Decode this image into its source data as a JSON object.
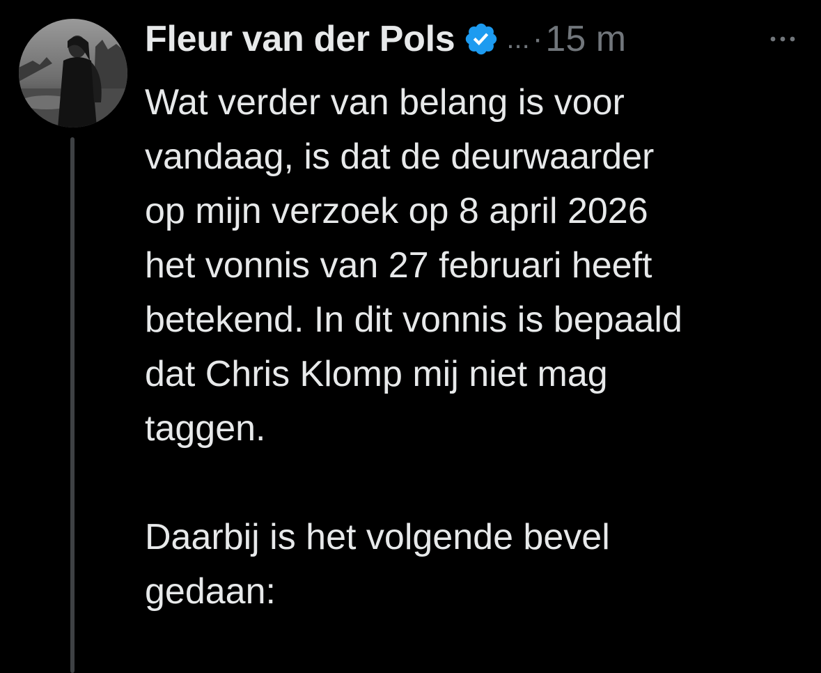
{
  "post": {
    "author_name": "Fleur van der Pols",
    "verified": true,
    "truncation": "...",
    "separator": "·",
    "timestamp": "15 m",
    "paragraphs": [
      "Wat verder van belang is voor\nvandaag, is dat de deurwaarder\nop mijn verzoek op 8 april 2026\nhet vonnis van 27 februari heeft\nbetekend. In dit vonnis is bepaald\ndat Chris Klomp mij niet mag\ntaggen.",
      "Daarbij is het volgende bevel\ngedaan:"
    ]
  },
  "icons": {
    "avatar": "profile-photo",
    "verified": "verified-badge-icon",
    "more": "more-options-icon"
  },
  "colors": {
    "background": "#000000",
    "text_primary": "#e7e9ea",
    "text_secondary": "#71767b",
    "verified_blue": "#1d9bf0",
    "thread_line": "#3e4144"
  }
}
